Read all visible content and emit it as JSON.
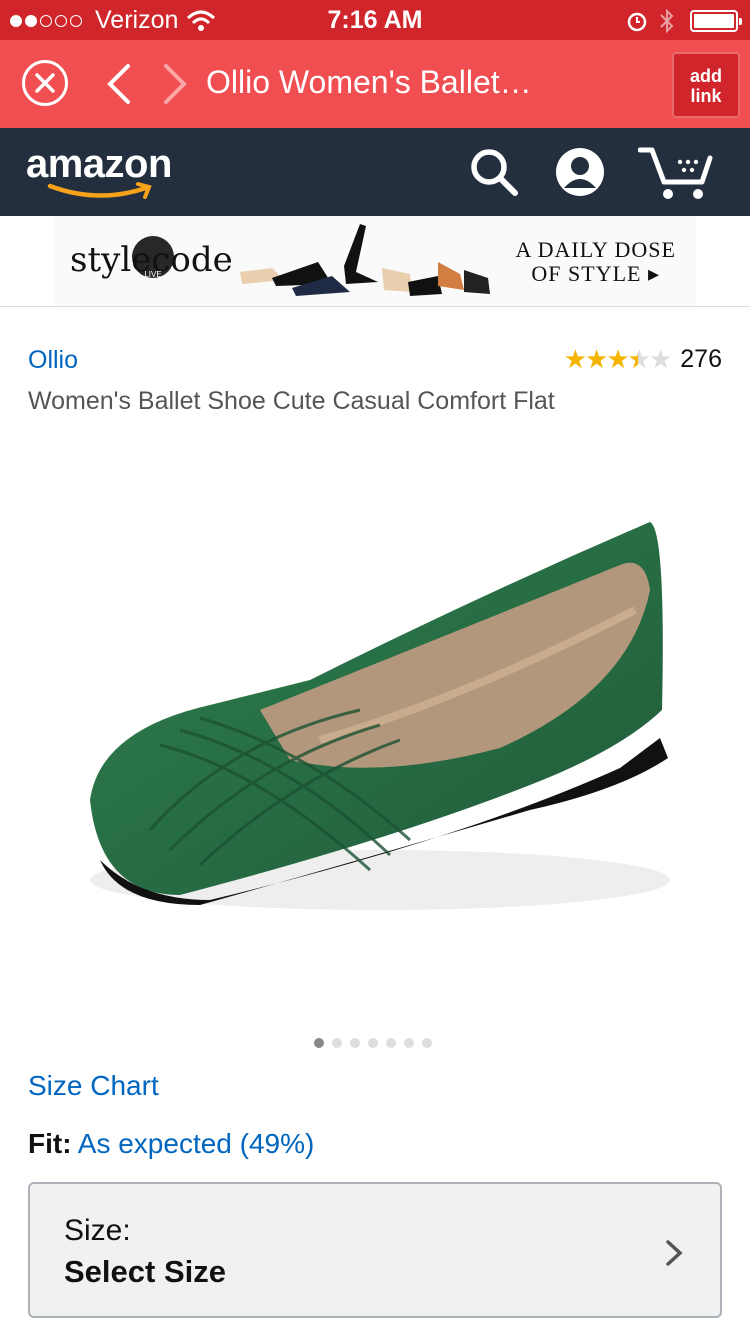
{
  "status_bar": {
    "carrier": "Verizon",
    "time": "7:16 AM",
    "signal_bars": 2
  },
  "browser": {
    "title": "Ollio Women's Ballet…",
    "add_link_line1": "add",
    "add_link_line2": "link"
  },
  "amazon": {
    "logo": "amazon"
  },
  "banner": {
    "brand": "stylecode",
    "live": "LIVE",
    "tagline1": "A DAILY DOSE",
    "tagline2": "OF STYLE ▸"
  },
  "product": {
    "brand": "Ollio",
    "rating": 3.5,
    "review_count": "276",
    "title": "Women's Ballet Shoe Cute Casual Comfort Flat",
    "image_count": 7,
    "active_image": 1
  },
  "size_chart_label": "Size Chart",
  "fit": {
    "label": "Fit:",
    "value": "As expected (49%)"
  },
  "size_selector": {
    "label": "Size:",
    "value": "Select Size"
  },
  "colors": {
    "status": "#d0262b",
    "toolbar": "#f04e51",
    "amazon_header": "#232f3e",
    "link": "#0066c0",
    "star": "#f4b400",
    "shoe": "#2e7a4a"
  }
}
